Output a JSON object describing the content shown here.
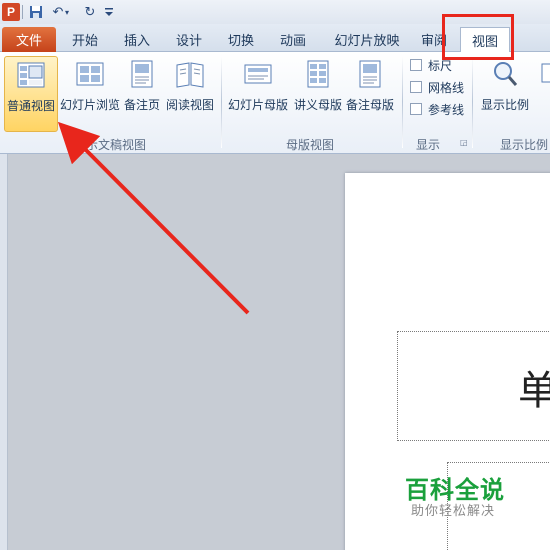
{
  "qat": {
    "logo": "P",
    "save_icon": "save-icon",
    "undo_icon": "undo-icon",
    "redo_icon": "redo-icon",
    "more_icon": "customize-icon"
  },
  "tabs": {
    "file": "文件",
    "home": "开始",
    "insert": "插入",
    "design": "设计",
    "transitions": "切换",
    "animations": "动画",
    "slideshow": "幻灯片放映",
    "review": "审阅",
    "view": "视图"
  },
  "ribbon": {
    "presentation_views": {
      "label": "演示文稿视图",
      "normal": "普通视图",
      "slide_sorter": "幻灯片浏览",
      "notes_page": "备注页",
      "reading_view": "阅读视图"
    },
    "master_views": {
      "label": "母版视图",
      "slide_master": "幻灯片母版",
      "handout_master": "讲义母版",
      "notes_master": "备注母版"
    },
    "show": {
      "label": "显示",
      "ruler": "标尺",
      "gridlines": "网格线",
      "guides": "参考线"
    },
    "zoom": {
      "label": "显示比例",
      "zoom": "显示比例"
    }
  },
  "slide": {
    "title_char": "单"
  },
  "watermark": {
    "title": "百科全说",
    "subtitle": "助你轻松解决"
  },
  "colors": {
    "highlight": "#e8261c",
    "file_tab": "#d24726",
    "selected_button": "#ffd463"
  }
}
